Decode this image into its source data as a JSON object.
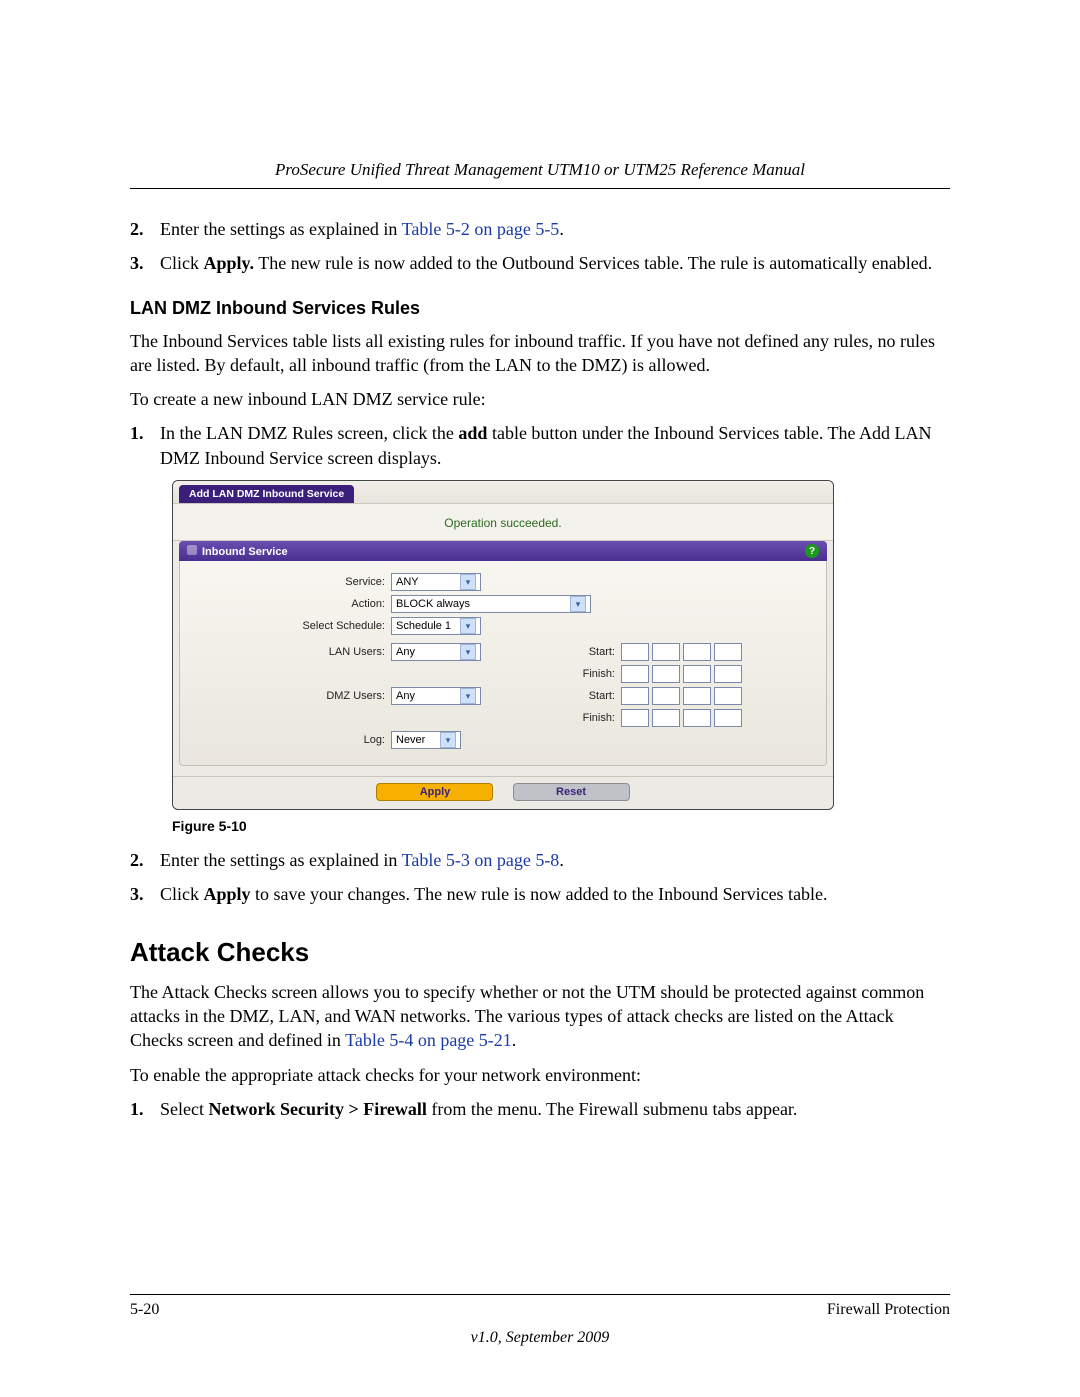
{
  "header": {
    "running": "ProSecure Unified Threat Management UTM10 or UTM25 Reference Manual"
  },
  "steps_top": [
    {
      "n": "2.",
      "prefix": "Enter the settings as explained in ",
      "link": "Table 5-2 on page 5-5",
      "suffix": "."
    },
    {
      "n": "3.",
      "prefix": "Click ",
      "bold": "Apply.",
      "suffix": " The new rule is now added to the Outbound Services table. The rule is automatically enabled."
    }
  ],
  "subhead1": "LAN DMZ Inbound Services Rules",
  "para1": "The Inbound Services table lists all existing rules for inbound traffic. If you have not defined any rules, no rules are listed. By default, all inbound traffic (from the LAN to the DMZ) is allowed.",
  "para2": "To create a new inbound LAN DMZ service rule:",
  "steps_mid": [
    {
      "n": "1.",
      "prefix": "In the LAN DMZ Rules screen, click the ",
      "bold": "add",
      "suffix": " table button under the Inbound Services table. The Add LAN DMZ Inbound Service screen displays."
    }
  ],
  "screenshot": {
    "tab": "Add LAN DMZ Inbound Service",
    "status": "Operation succeeded.",
    "panel_title": "Inbound Service",
    "help": "?",
    "rows": {
      "service_label": "Service:",
      "service_value": "ANY",
      "action_label": "Action:",
      "action_value": "BLOCK always",
      "schedule_label": "Select Schedule:",
      "schedule_value": "Schedule 1",
      "lan_label": "LAN Users:",
      "lan_value": "Any",
      "dmz_label": "DMZ Users:",
      "dmz_value": "Any",
      "log_label": "Log:",
      "log_value": "Never",
      "start_label": "Start:",
      "finish_label": "Finish:"
    },
    "buttons": {
      "apply": "Apply",
      "reset": "Reset"
    }
  },
  "figure_caption": "Figure 5-10",
  "steps_bottom": [
    {
      "n": "2.",
      "prefix": "Enter the settings as explained in ",
      "link": "Table 5-3 on page 5-8",
      "suffix": "."
    },
    {
      "n": "3.",
      "prefix": "Click ",
      "bold": "Apply",
      "suffix": " to save your changes. The new rule is now added to the Inbound Services table."
    }
  ],
  "section2": "Attack Checks",
  "para3_a": "The Attack Checks screen allows you to specify whether or not the UTM should be protected against common attacks in the DMZ, LAN, and WAN networks. The various types of attack checks are listed on the Attack Checks screen and defined in ",
  "para3_link": "Table 5-4 on page 5-21",
  "para3_b": ".",
  "para4": "To enable the appropriate attack checks for your network environment:",
  "steps_last": [
    {
      "n": "1.",
      "prefix": "Select ",
      "bold": "Network Security > Firewall",
      "suffix": " from the menu. The Firewall submenu tabs appear."
    }
  ],
  "footer": {
    "left": "5-20",
    "right": "Firewall Protection",
    "version": "v1.0, September 2009"
  }
}
